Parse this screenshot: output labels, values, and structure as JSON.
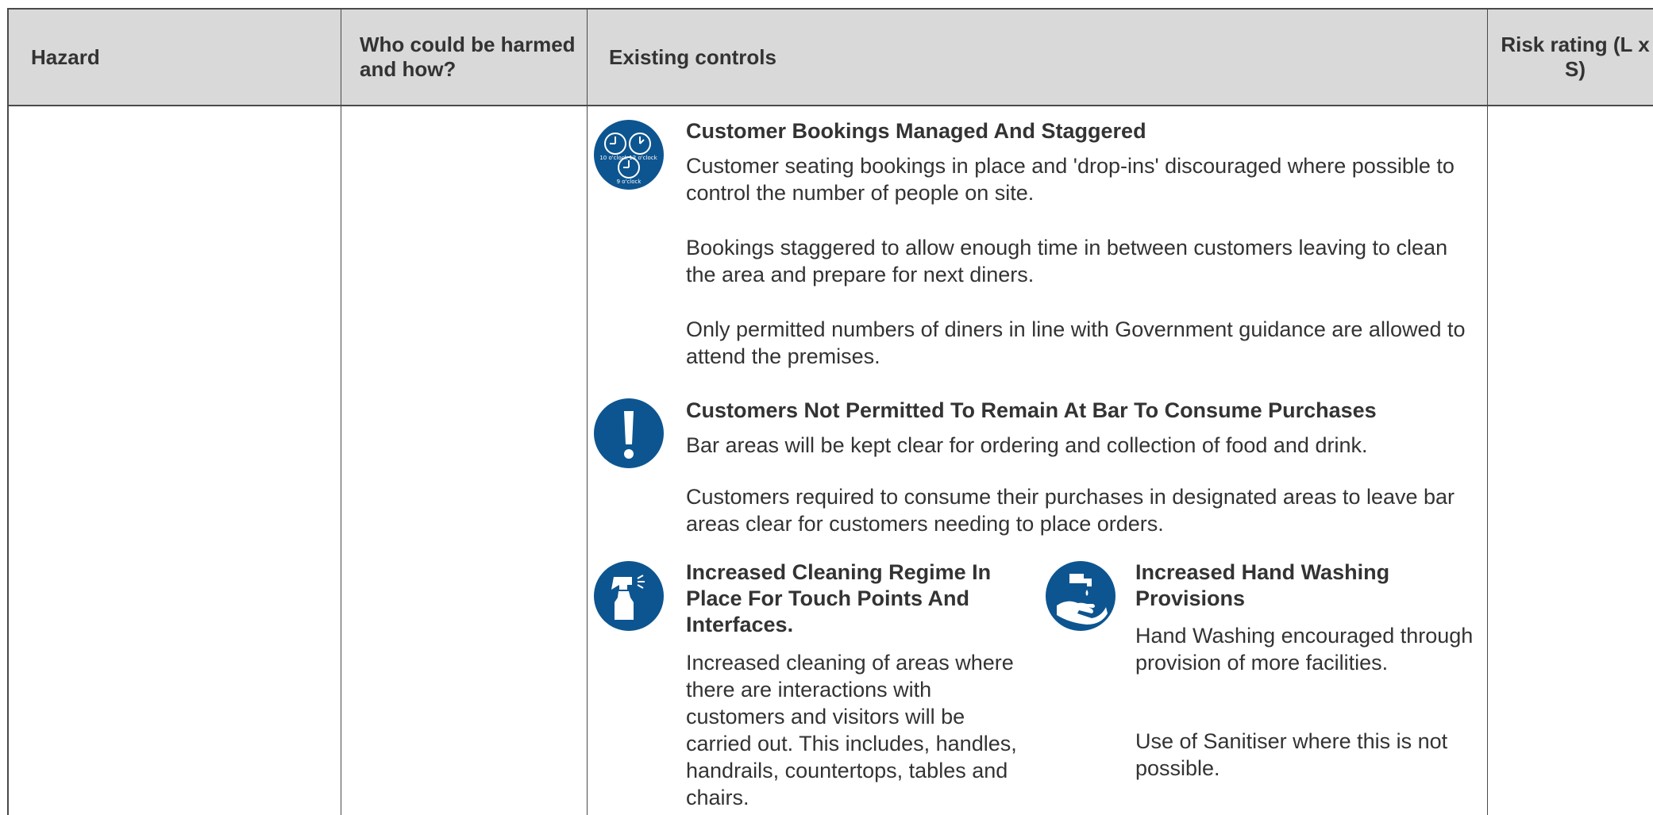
{
  "header": {
    "hazard": "Hazard",
    "who": "Who could be harmed and how?",
    "controls": "Existing controls",
    "risk": "Risk rating (L x S)"
  },
  "controls": [
    {
      "icon": "clock-icon",
      "icon_labels": [
        "10 o'clock",
        "12 o'clock",
        "9 o'clock"
      ],
      "title": "Customer Bookings Managed And Staggered",
      "paragraphs": [
        "Customer seating bookings in place and 'drop-ins' discouraged where possible to control the number of people on site.",
        "Bookings staggered to allow enough time in between customers leaving to clean the area and prepare for next diners.",
        "Only permitted numbers of diners in line with Government guidance are allowed to attend the premises."
      ]
    },
    {
      "icon": "exclamation-icon",
      "title": "Customers Not Permitted To Remain At Bar To Consume Purchases",
      "paragraphs": [
        "Bar areas will be kept clear for ordering and collection of food and drink.",
        "Customers required to consume their purchases in designated areas to leave bar areas clear for customers needing to place orders."
      ]
    },
    {
      "icon": "spray-bottle-icon",
      "title": "Increased Cleaning Regime In Place For Touch Points And Interfaces.",
      "paragraphs": [
        "Increased cleaning of areas where there are interactions with customers and visitors will be carried out. This includes, handles, handrails, countertops, tables and chairs."
      ]
    },
    {
      "icon": "hand-washing-icon",
      "title": "Increased Hand Washing Provisions",
      "paragraphs": [
        "Hand Washing encouraged through provision of more facilities.",
        "Use of Sanitiser where this is not possible."
      ]
    }
  ],
  "colors": {
    "header_bg": "#d9d9d9",
    "icon_bg": "#0d5590",
    "text": "#333333",
    "border": "#4a4a4a"
  }
}
